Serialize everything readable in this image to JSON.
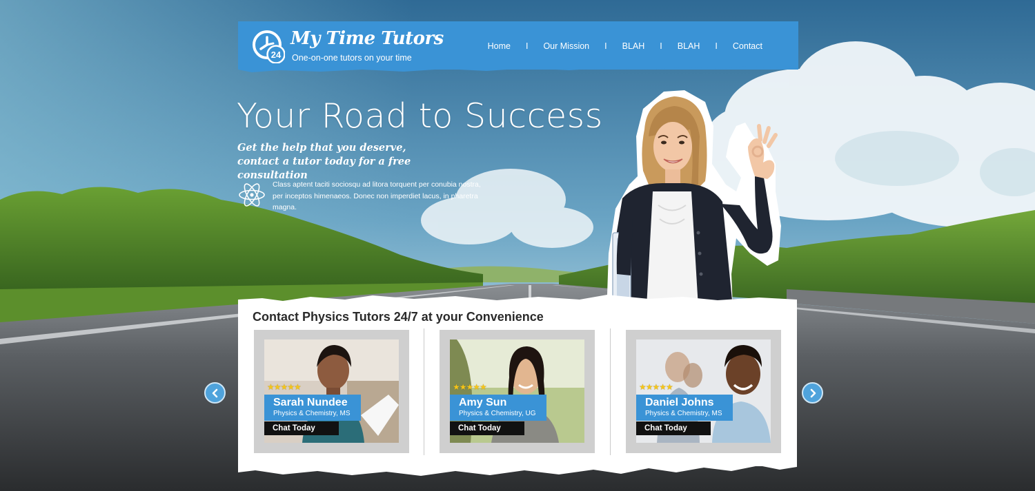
{
  "brand": {
    "title": "My Time Tutors",
    "tagline": "One-on-one tutors on your time",
    "badge": "24",
    "color": "#3a93d6"
  },
  "nav": {
    "items": [
      "Home",
      "Our Mission",
      "BLAH",
      "BLAH",
      "Contact"
    ],
    "separator": "I"
  },
  "hero": {
    "title": "Your Road to Success",
    "subtitle_line1": "Get the help that you deserve,",
    "subtitle_line2": "contact a tutor today for a free consultation",
    "body": "Class aptent taciti sociosqu ad litora torquent per conubia nostra, per inceptos himenaeos. Donec non imperdiet lacus, in pharetra magna.",
    "icon": "atom-icon"
  },
  "tutors_section": {
    "title": "Contact Physics Tutors 24/7 at your Convenience",
    "rating_stars": "★★★★★",
    "chat_label": "Chat Today",
    "tutors": [
      {
        "name": "Sarah Nundee",
        "subject": "Physics & Chemistry, MS"
      },
      {
        "name": "Amy Sun",
        "subject": "Physics & Chemistry, UG"
      },
      {
        "name": "Daniel Johns",
        "subject": "Physics & Chemistry, MS"
      }
    ]
  },
  "carousel": {
    "prev_icon": "chevron-left-icon",
    "next_icon": "chevron-right-icon"
  }
}
